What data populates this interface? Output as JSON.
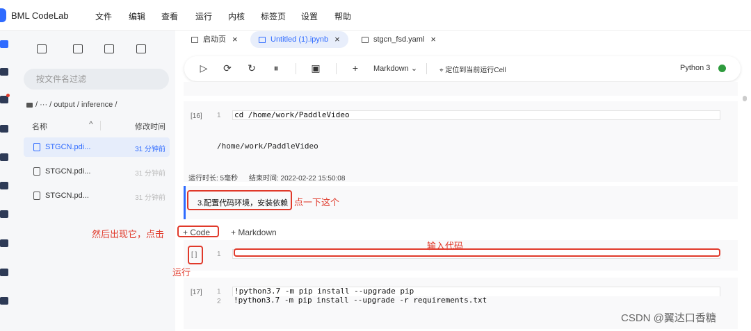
{
  "app": {
    "title": "BML CodeLab"
  },
  "menu": [
    "文件",
    "编辑",
    "查看",
    "运行",
    "内核",
    "标签页",
    "设置",
    "帮助"
  ],
  "sidebar": {
    "icons": [
      "folder-icon",
      "dashboard-icon",
      "extension-icon",
      "toolbox-icon",
      "cube-icon",
      "apps-icon",
      "layers-icon",
      "terminal-icon",
      "plugin-icon",
      "chip-icon"
    ]
  },
  "file_panel": {
    "tool_icons": [
      "new-file-icon",
      "new-folder-icon",
      "upload-icon",
      "refresh-icon"
    ],
    "search_placeholder": "按文件名过滤",
    "breadcrumb": "/ ··· / output / inference /",
    "col_name": "名称",
    "col_modified": "修改时间",
    "files": [
      {
        "name": "STGCN.pdi...",
        "time": "31 分钟前",
        "active": true
      },
      {
        "name": "STGCN.pdi...",
        "time": "31 分钟前",
        "active": false
      },
      {
        "name": "STGCN.pd...",
        "time": "31 分钟前",
        "active": false
      }
    ]
  },
  "tabs": [
    {
      "label": "启动页",
      "active": false
    },
    {
      "label": "Untitled (1).ipynb",
      "active": true
    },
    {
      "label": "stgcn_fsd.yaml",
      "active": false
    }
  ],
  "toolbar": {
    "markdown_label": "Markdown",
    "locate_label": "定位到当前运行Cell",
    "kernel_name": "Python 3",
    "kernel_status_color": "#2e9b3d"
  },
  "cells": {
    "cell16": {
      "prompt": "[16]",
      "lineno": "1",
      "code": "cd /home/work/PaddleVideo",
      "output": "/home/work/PaddleVideo",
      "duration_label": "运行时长: 5毫秒",
      "end_label": "结束时间: 2022-02-22 15:50:08"
    },
    "markdown_cell": {
      "text": "3.配置代码环境，安装依赖"
    },
    "add_code_label": "+ Code",
    "add_markdown_label": "+ Markdown",
    "new_cell": {
      "prompt": "[ ]",
      "lineno": "1"
    },
    "cell17": {
      "prompt": "[17]",
      "lines": [
        {
          "no": "1",
          "code": "!python3.7 -m pip install --upgrade pip"
        },
        {
          "no": "2",
          "code": "!python3.7 -m pip install --upgrade -r requirements.txt"
        }
      ]
    }
  },
  "annotations": {
    "click_here": "点一下这个",
    "then_appears": "然后出现它，点击",
    "input_code": "输入代码",
    "run": "运行",
    "color": "#e0392a"
  },
  "watermark": "CSDN @翼达口香糖"
}
